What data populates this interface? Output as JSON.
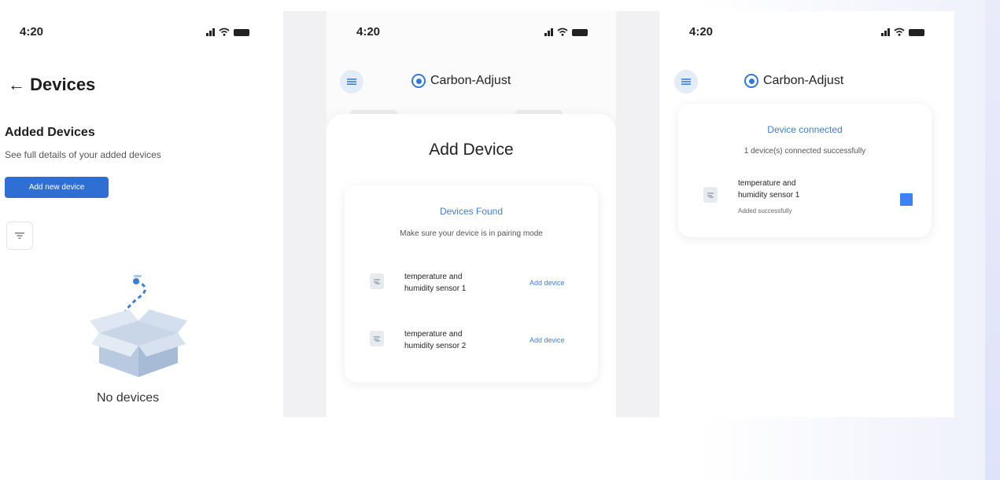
{
  "status_time": "4:20",
  "screen1": {
    "title": "← Devices",
    "section_title": "Added Devices",
    "section_subtitle": "See full details of your added devices",
    "add_button_label": "Add new device",
    "empty_state": "No devices"
  },
  "brand": {
    "name": "Carbon-Adjust"
  },
  "screen2": {
    "page_title": "Add Device",
    "card_title": "Devices Found",
    "card_subtitle": "Make sure your device is in pairing mode",
    "devices": [
      {
        "line1": "temperature and",
        "line2": "humidity sensor 1",
        "action": "Add device"
      },
      {
        "line1": "temperature and",
        "line2": "humidity sensor 2",
        "action": "Add device"
      }
    ]
  },
  "screen3": {
    "card_title": "Device connected",
    "card_subtitle": "1 device(s) connected successfully",
    "device": {
      "line1": "temperature and",
      "line2": "humidity sensor 1",
      "status": "Added successfully"
    }
  },
  "colors": {
    "accent": "#2f6fd4",
    "link": "#3d7fd6",
    "status_square": "#3b82f6"
  },
  "icons": [
    "signal-icon",
    "wifi-icon",
    "battery-icon",
    "filter-icon",
    "menu-icon",
    "brand-logo-icon",
    "sensor-icon",
    "empty-box-icon"
  ]
}
